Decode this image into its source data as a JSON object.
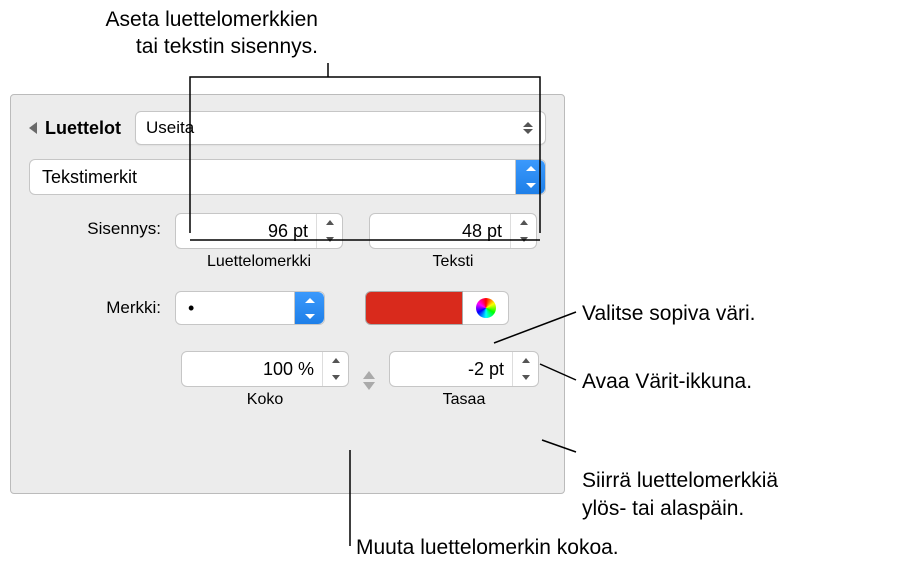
{
  "callouts": {
    "top": "Aseta luettelomerkkien\ntai tekstin sisennys.",
    "color": "Valitse sopiva väri.",
    "colorwindow": "Avaa Värit-ikkuna.",
    "align": "Siirrä luettelomerkkiä\nylös- tai alaspäin.",
    "size": "Muuta luettelomerkin kokoa."
  },
  "panel": {
    "section": "Luettelot",
    "list_style": "Useita",
    "type": "Tekstimerkit",
    "indent_label": "Sisennys:",
    "bullet_indent": "96 pt",
    "text_indent": "48 pt",
    "bullet_sublabel": "Luettelomerkki",
    "text_sublabel": "Teksti",
    "char_label": "Merkki:",
    "char_value": "•",
    "size_value": "100 %",
    "size_sublabel": "Koko",
    "align_value": "-2 pt",
    "align_sublabel": "Tasaa",
    "swatch_color": "#d92a1c"
  }
}
